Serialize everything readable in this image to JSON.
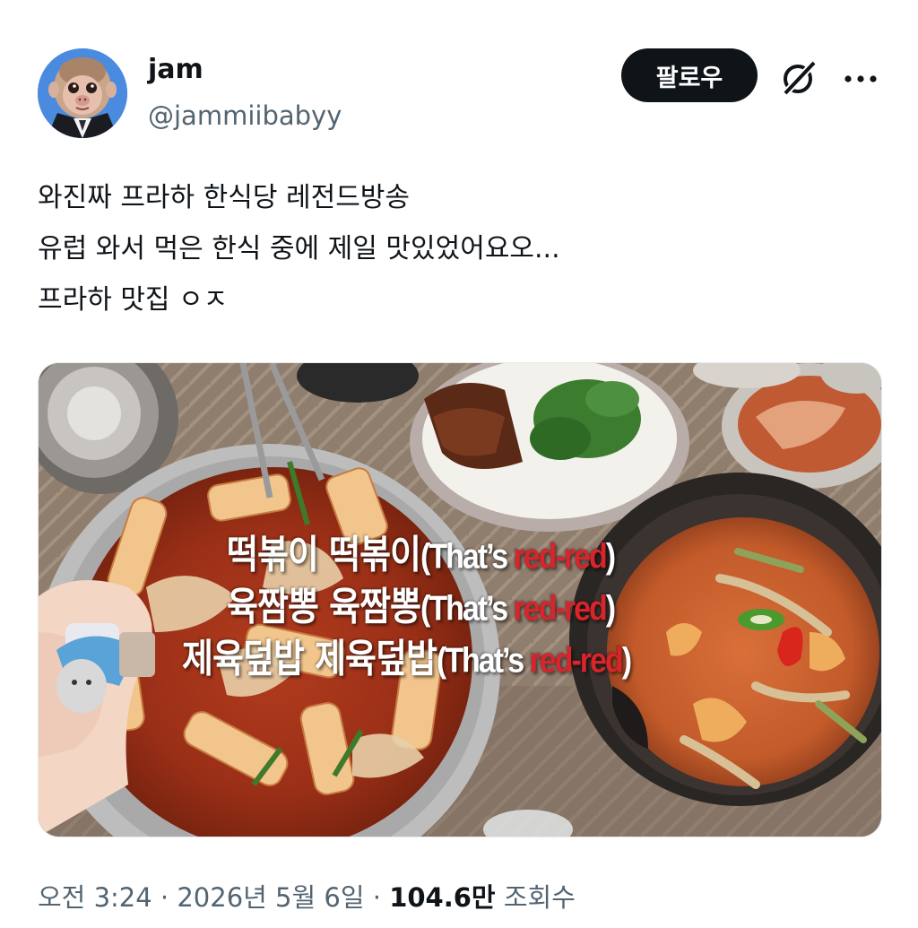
{
  "author": {
    "name": "jam",
    "handle": "@jammiibabyy",
    "avatar_icon": "monkey-in-suit-avatar"
  },
  "actions": {
    "follow_label": "팔로우",
    "grok_icon": "grok-slash-icon",
    "more_icon": "more-dots-icon"
  },
  "tweet": {
    "lines": [
      "와진짜 프라하 한식당 레전드방송",
      "유럽 와서 먹은 한식 중에 제일 맛있었어요오...",
      "프라하 맛집 ㅇㅈ"
    ]
  },
  "media": {
    "captions": [
      {
        "korean": "떡볶이 떡볶이",
        "open": "(That’s ",
        "red": "red-red",
        "close": ")"
      },
      {
        "korean": "육짬뽕 육짬뽕",
        "open": "(That’s ",
        "red": "red-red",
        "close": ")"
      },
      {
        "korean": "제육덮밥 제육덮밥",
        "open": "(That’s ",
        "red": "red-red",
        "close": ")"
      }
    ],
    "accent_red": "#d8242b"
  },
  "meta": {
    "time": "오전 3:24",
    "sep1": "·",
    "date": "2026년 5월 6일",
    "sep2": "·",
    "views_count": "104.6만",
    "views_label": "조회수"
  }
}
